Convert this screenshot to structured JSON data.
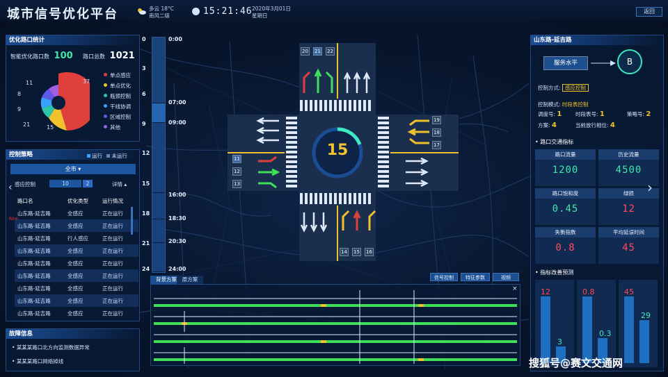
{
  "header": {
    "title": "城市信号优化平台",
    "weather_line1": "多云  18°C",
    "weather_line2": "南风二级",
    "time": "15:21:46",
    "date": "2020年3月01日",
    "weekday": "星期日",
    "back_label": "返回"
  },
  "stats": {
    "title": "优化路口统计",
    "optimized_label": "智能优化路口数",
    "optimized_value": "100",
    "total_label": "路口总数",
    "total_value": "1021",
    "pie_labels": [
      "37",
      "11",
      "8",
      "9",
      "21",
      "15"
    ],
    "legend": [
      {
        "label": "单点感应",
        "color": "#e0403c"
      },
      {
        "label": "单点优化",
        "color": "#f2c12e"
      },
      {
        "label": "瓶颈控制",
        "color": "#2cc4a8"
      },
      {
        "label": "干线协调",
        "color": "#3aa0ff"
      },
      {
        "label": "区域控制",
        "color": "#5e5ae8"
      },
      {
        "label": "其他",
        "color": "#a05fe0"
      }
    ]
  },
  "strategy": {
    "title": "控制策略",
    "running_label": "运行",
    "not_running_label": "未运行",
    "city_select": "全市",
    "filter_label": "感应控制",
    "filter_count_a": "10",
    "filter_count_b": "2",
    "detail_label": "详情",
    "red_tag": "Rinn",
    "columns": [
      "路口名",
      "优化类型",
      "运行情况"
    ],
    "rows": [
      [
        "山东路-延吉路",
        "全感应",
        "正在运行"
      ],
      [
        "山东路-延吉路",
        "全感应",
        "正在运行"
      ],
      [
        "山东路-延吉路",
        "行人感应",
        "正在运行"
      ],
      [
        "山东路-延吉路",
        "全感应",
        "正在运行"
      ],
      [
        "山东路-延吉路",
        "全感应",
        "正在运行"
      ],
      [
        "山东路-延吉路",
        "全感应",
        "正在运行"
      ],
      [
        "山东路-延吉路",
        "全感应",
        "正在运行"
      ],
      [
        "山东路-延吉路",
        "全感应",
        "正在运行"
      ],
      [
        "山东路-延吉路",
        "全感应",
        "正在运行"
      ]
    ]
  },
  "faults": {
    "title": "故障信息",
    "items": [
      "某某某路口北方向监测数据异常",
      "某某某路口网络掉线"
    ]
  },
  "timeline": {
    "hours": [
      "0",
      "3",
      "6",
      "9",
      "12",
      "15",
      "18",
      "21",
      "24"
    ],
    "times": [
      "0:00",
      "07:00",
      "09:00",
      "16:00",
      "18:30",
      "20:30",
      "24:00"
    ]
  },
  "intersection": {
    "countdown": "15",
    "north_lanes": [
      "20",
      "21",
      "22"
    ],
    "east_lanes": [
      "19",
      "18",
      "17"
    ],
    "west_lanes": [
      "11",
      "12",
      "13"
    ],
    "south_lanes": [
      "14",
      "15",
      "16"
    ]
  },
  "bottom_tabs": {
    "tab1": "背景方案",
    "tab2": "原方案",
    "btn_signal": "信号控制",
    "btn_params": "特征参数",
    "btn_video": "视频",
    "close": "×"
  },
  "right": {
    "title": "山东路-延吉路",
    "service_label": "服务水平",
    "service_grade": "B",
    "control_mode_label": "控制方式:",
    "control_mode_value": "感应控制",
    "control_pattern_label": "控制模式:",
    "control_pattern_value": "时段表控制",
    "schedule_label": "调度号:",
    "schedule_value": "1",
    "period_label": "时段表号:",
    "period_value": "1",
    "strategy_label": "策略号:",
    "strategy_value": "2",
    "plan_label": "方案:",
    "plan_value": "4",
    "phase_label": "当前放行相位:",
    "phase_value": "4",
    "metrics_title": "路口交通指标",
    "metrics": [
      {
        "label": "路口流量",
        "value": "1200",
        "color": "#3ee8a8"
      },
      {
        "label": "历史流量",
        "value": "4500",
        "color": "#3ee8a8"
      },
      {
        "label": "路口饱和度",
        "value": "0.45",
        "color": "#3ee8a8"
      },
      {
        "label": "绿损",
        "value": "12",
        "color": "#ff4a5a"
      },
      {
        "label": "失衡指数",
        "value": "0.8",
        "color": "#ff4a5a"
      },
      {
        "label": "平均延误时间",
        "value": "45",
        "color": "#ff4a5a"
      }
    ],
    "forecast_title": "指标改善预测"
  },
  "chart_data": {
    "type": "bar",
    "series": [
      {
        "values": [
          12,
          3
        ]
      },
      {
        "values": [
          0.8,
          0.3
        ]
      },
      {
        "values": [
          45,
          29
        ]
      }
    ]
  },
  "watermark": "搜狐号@赛文交通网"
}
